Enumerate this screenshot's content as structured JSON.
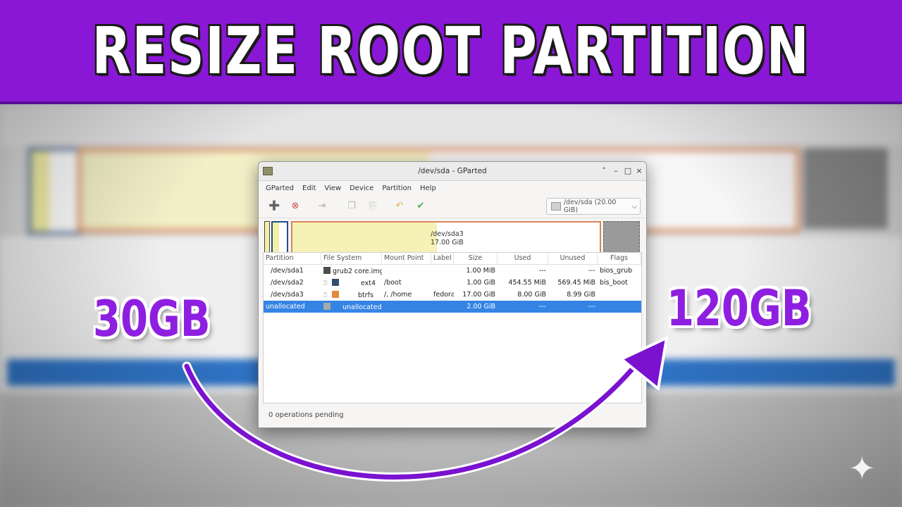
{
  "banner": {
    "title": "RESIZE ROOT PARTITION"
  },
  "labels": {
    "left": "30GB",
    "right": "120GB"
  },
  "window": {
    "title": "/dev/sda - GParted",
    "controls": [
      "˄",
      "–",
      "□",
      "×"
    ]
  },
  "menu": [
    "GParted",
    "Edit",
    "View",
    "Device",
    "Partition",
    "Help"
  ],
  "device_selector": {
    "label": "/dev/sda  (20.00 GiB)"
  },
  "disk_map": {
    "main_partition": "/dev/sda3",
    "main_size": "17.00 GiB",
    "used_fraction": 0.47
  },
  "table": {
    "headers": [
      "Partition",
      "File System",
      "Mount Point",
      "Label",
      "Size",
      "Used",
      "Unused",
      "Flags"
    ],
    "rows": [
      {
        "partition": "/dev/sda1",
        "fs": "grub2 core.img",
        "fs_color": "#4d4d4d",
        "mount": "",
        "label": "",
        "size": "1.00 MiB",
        "used": "---",
        "unused": "---",
        "flags": "bios_grub"
      },
      {
        "partition": "/dev/sda2",
        "fs": "ext4",
        "fs_color": "#314e6c",
        "mount": "/boot",
        "label": "",
        "size": "1.00 GiB",
        "used": "454.55 MiB",
        "unused": "569.45 MiB",
        "flags": "bis_boot"
      },
      {
        "partition": "/dev/sda3",
        "fs": "btrfs",
        "fs_color": "#e08a3c",
        "mount": "/, /home",
        "label": "fedora",
        "size": "17.00 GiB",
        "used": "8.00 GiB",
        "unused": "8.99 GiB",
        "flags": ""
      },
      {
        "partition": "unallocated",
        "fs": "unallocated",
        "fs_color": "#a8a8a8",
        "mount": "",
        "label": "",
        "size": "2.00 GiB",
        "used": "---",
        "unused": "---",
        "flags": ""
      }
    ]
  },
  "status": "0 operations pending",
  "colors": {
    "banner": "#8a17d6",
    "label": "#8e1fe0",
    "arrow": "#7a12d0",
    "selection": "#3584e4"
  }
}
